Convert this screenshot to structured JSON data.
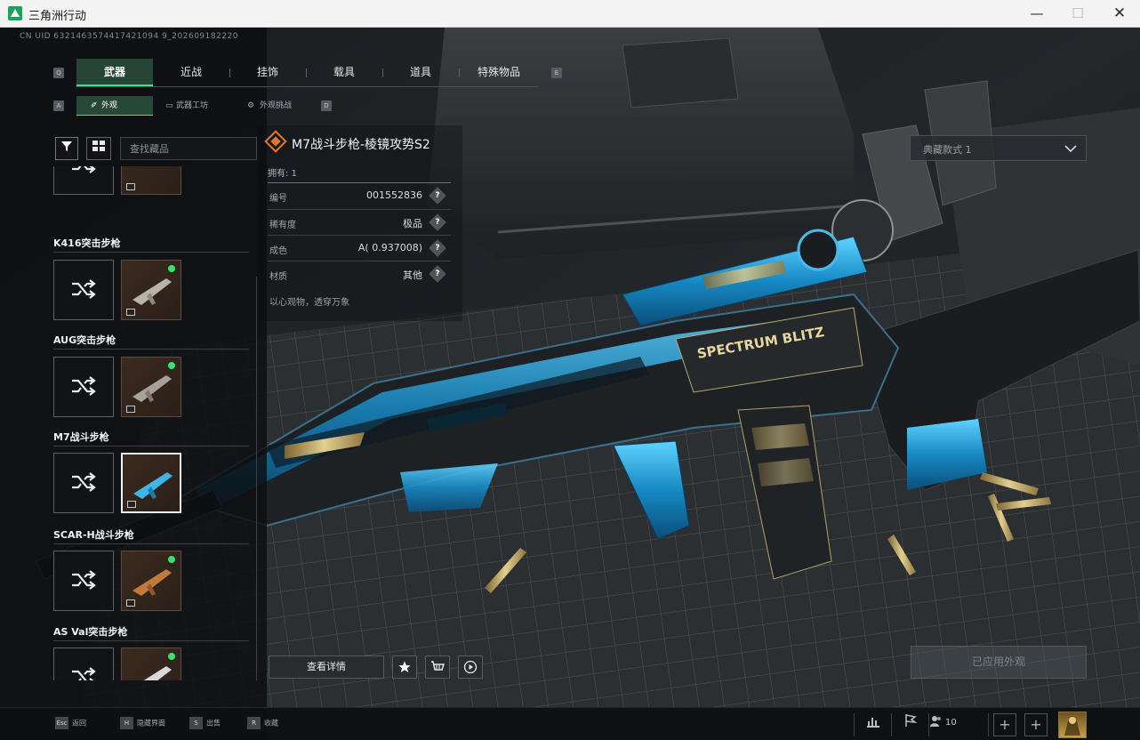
{
  "window": {
    "title": "三角洲行动",
    "min": "—",
    "max": "☐",
    "close": "✕"
  },
  "uid": "CN UID 6321463574417421094 9_202609182220",
  "key_hints": {
    "prev_tab": "Q",
    "next_tab": "E",
    "prev_sub": "A",
    "next_sub": "D"
  },
  "main_tabs": [
    "武器",
    "近战",
    "挂饰",
    "载具",
    "道具",
    "特殊物品"
  ],
  "sub_tabs": [
    {
      "icon": "✐",
      "label": "外观"
    },
    {
      "icon": "▭",
      "label": "武器工坊"
    },
    {
      "icon": "⚙",
      "label": "外观挑战"
    }
  ],
  "search": {
    "placeholder": "查找藏品"
  },
  "weapon_groups": [
    {
      "name": "K416突击步枪"
    },
    {
      "name": "AUG突击步枪"
    },
    {
      "name": "M7战斗步枪"
    },
    {
      "name": "SCAR-H战斗步枪"
    },
    {
      "name": "AS Val突击步枪"
    }
  ],
  "item": {
    "title": "M7战斗步枪-棱镜攻势S2",
    "owned": "拥有: 1",
    "attributes": [
      {
        "label": "编号",
        "value": "001552836"
      },
      {
        "label": "稀有度",
        "value": "极品"
      },
      {
        "label": "成色",
        "value": "A( 0.937008)"
      },
      {
        "label": "材质",
        "value": "其他"
      }
    ],
    "help_glyph": "?",
    "description": "以心观物，透穿万象"
  },
  "preset_select": {
    "value": "典藏款式 1"
  },
  "apply_button": "已应用外观",
  "detail_button": "查看详情",
  "footer": {
    "hints": [
      {
        "key": "Esc",
        "label": "返回"
      },
      {
        "key": "H",
        "label": "隐藏界面"
      },
      {
        "key": "S",
        "label": "出售"
      },
      {
        "key": "R",
        "label": "收藏"
      }
    ],
    "player_count": "10"
  },
  "colors": {
    "accent": "#3fe08a",
    "active_tab_bg": "#264536",
    "owned_dot": "#2ee66d",
    "title_icon": "#e0772a"
  }
}
